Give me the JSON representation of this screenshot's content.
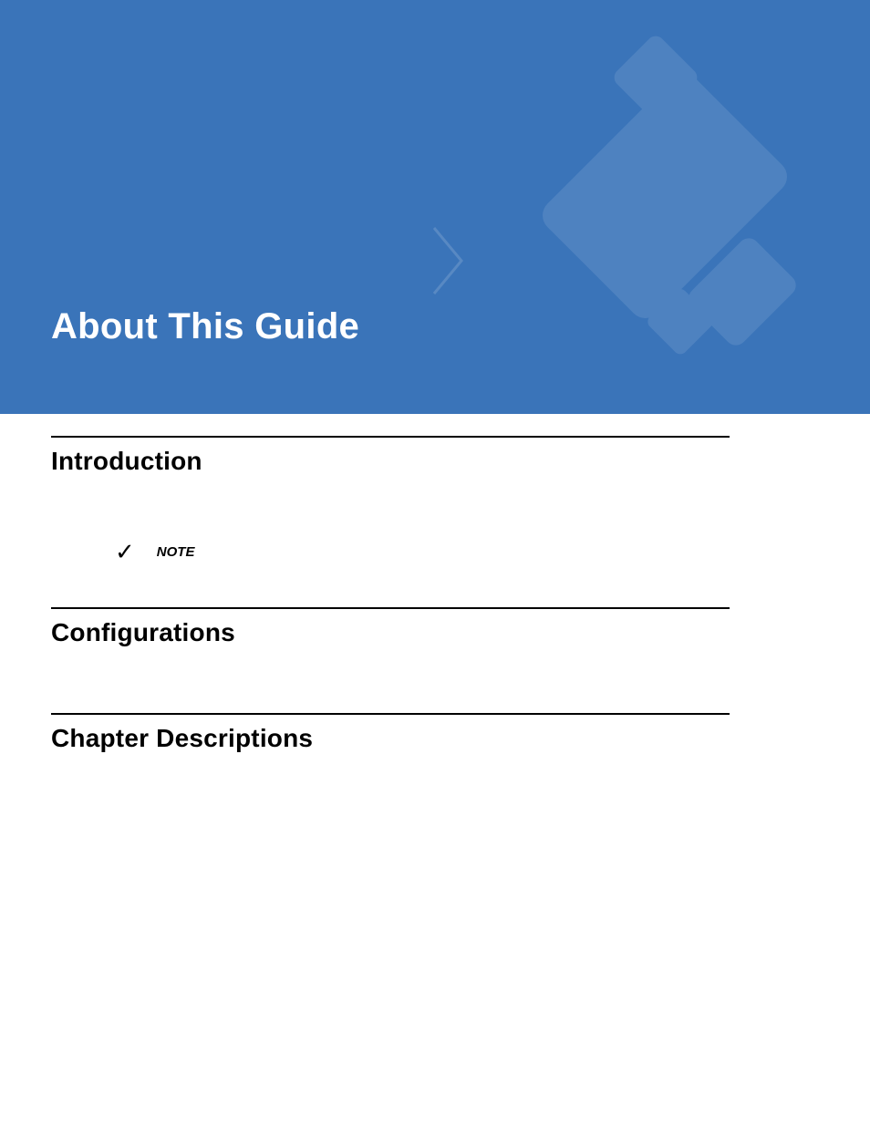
{
  "banner": {
    "title": "About This Guide"
  },
  "sections": {
    "introduction": {
      "heading": "Introduction"
    },
    "configurations": {
      "heading": "Configurations"
    },
    "chapter_descriptions": {
      "heading": "Chapter Descriptions"
    }
  },
  "note": {
    "label": "NOTE",
    "icon_glyph": "✓"
  }
}
